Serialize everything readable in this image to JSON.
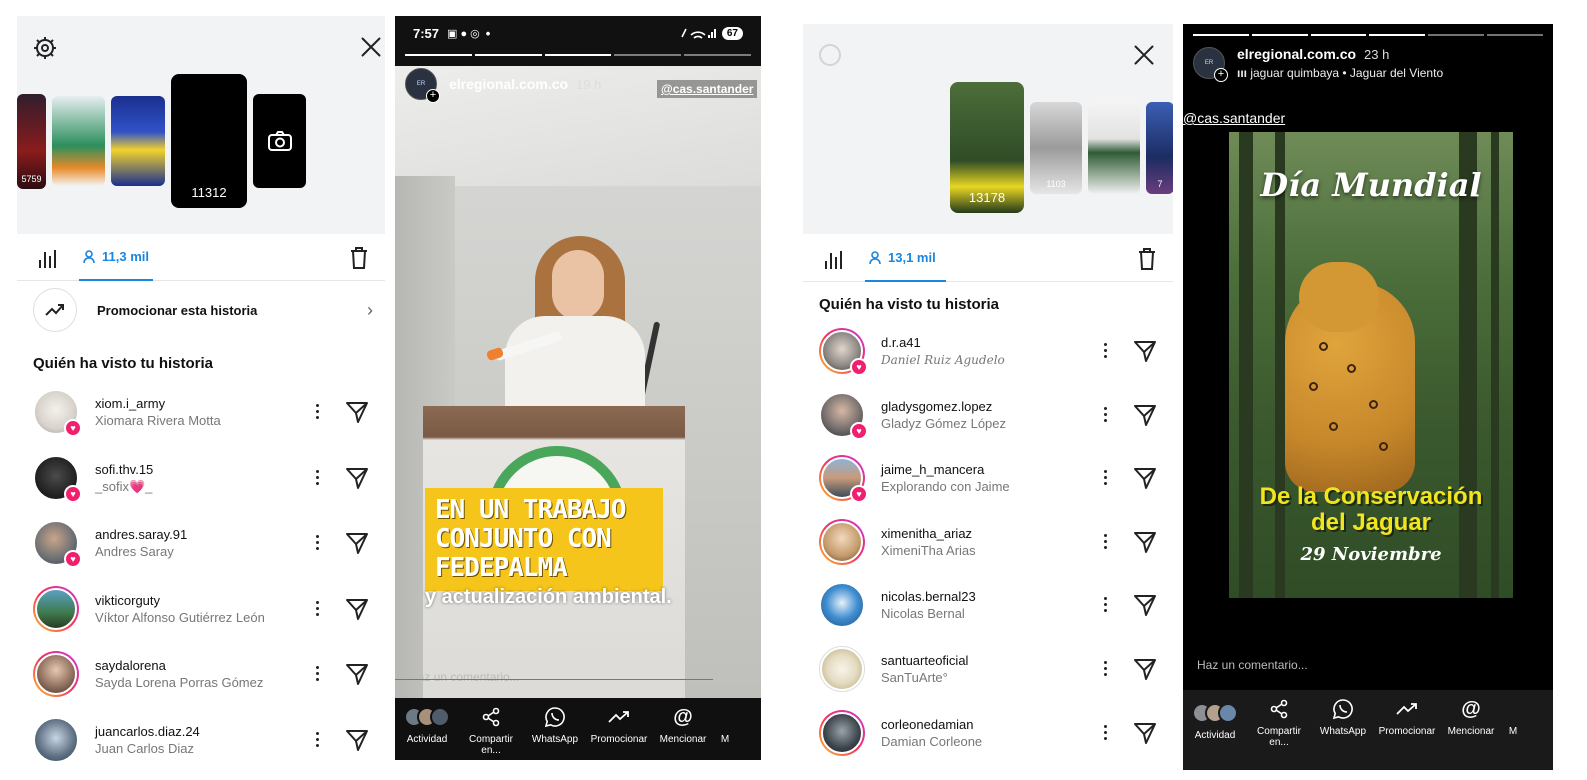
{
  "panel1": {
    "thumb_counts": [
      "5759",
      "",
      "",
      "11312"
    ],
    "tabs": {
      "views_label": "11,3 mil"
    },
    "promote_label": "Promocionar esta historia",
    "section_title": "Quién ha visto tu historia",
    "viewers": [
      {
        "username": "xiom.i_army",
        "fullname": "Xiomara Rivera Motta"
      },
      {
        "username": "sofi.thv.15",
        "fullname": "_sofix💗_"
      },
      {
        "username": "andres.saray.91",
        "fullname": "Andres Saray"
      },
      {
        "username": "vikticorguty",
        "fullname": "Víktor Alfonso Gutiérrez León"
      },
      {
        "username": "saydalorena",
        "fullname": "Sayda Lorena Porras Gómez"
      },
      {
        "username": "juancarlos.diaz.24",
        "fullname": "Juan Carlos Diaz"
      }
    ]
  },
  "story1": {
    "status_time": "7:57",
    "status_dot": "•",
    "battery": "67",
    "account": "elregional.com.co",
    "time_ago": "19 h",
    "mention": "@cas.santander",
    "caption": "EN UN TRABAJO CONJUNTO CON FEDEPALMA",
    "subtitle_partial": "y actualización ambiental.",
    "comment_placeholder": "Haz un comentario...",
    "actions": [
      "Actividad",
      "Compartir en...",
      "WhatsApp",
      "Promocionar",
      "Mencionar",
      "M"
    ]
  },
  "panel2": {
    "thumb_counts": [
      "13178",
      "1103",
      "",
      "7"
    ],
    "tabs": {
      "views_label": "13,1 mil"
    },
    "section_title": "Quién ha visto tu historia",
    "viewers": [
      {
        "username": "d.r.a41",
        "fullname": "Daniel Ruiz Agudelo"
      },
      {
        "username": "gladysgomez.lopez",
        "fullname": "Gladyz Gómez López"
      },
      {
        "username": "jaime_h_mancera",
        "fullname": "Explorando con Jaime"
      },
      {
        "username": "ximenitha_ariaz",
        "fullname": "XimeniTha Arias"
      },
      {
        "username": "nicolas.bernal23",
        "fullname": "Nicolas Bernal"
      },
      {
        "username": "santuarteoficial",
        "fullname": "SanTuArte°"
      },
      {
        "username": "corleonedamian",
        "fullname": "Damian Corleone"
      }
    ]
  },
  "story2": {
    "account": "elregional.com.co",
    "time_ago": "23 h",
    "music": "jaguar quimbaya • Jaguar del Viento",
    "mention": "@cas.santander",
    "art_title": "Día Mundial",
    "art_sub1": "De la Conservación",
    "art_sub2": "del Jaguar",
    "art_date": "29 Noviembre",
    "comment_placeholder": "Haz un comentario...",
    "actions": [
      "Actividad",
      "Compartir en...",
      "WhatsApp",
      "Promocionar",
      "Mencionar",
      "M"
    ]
  }
}
